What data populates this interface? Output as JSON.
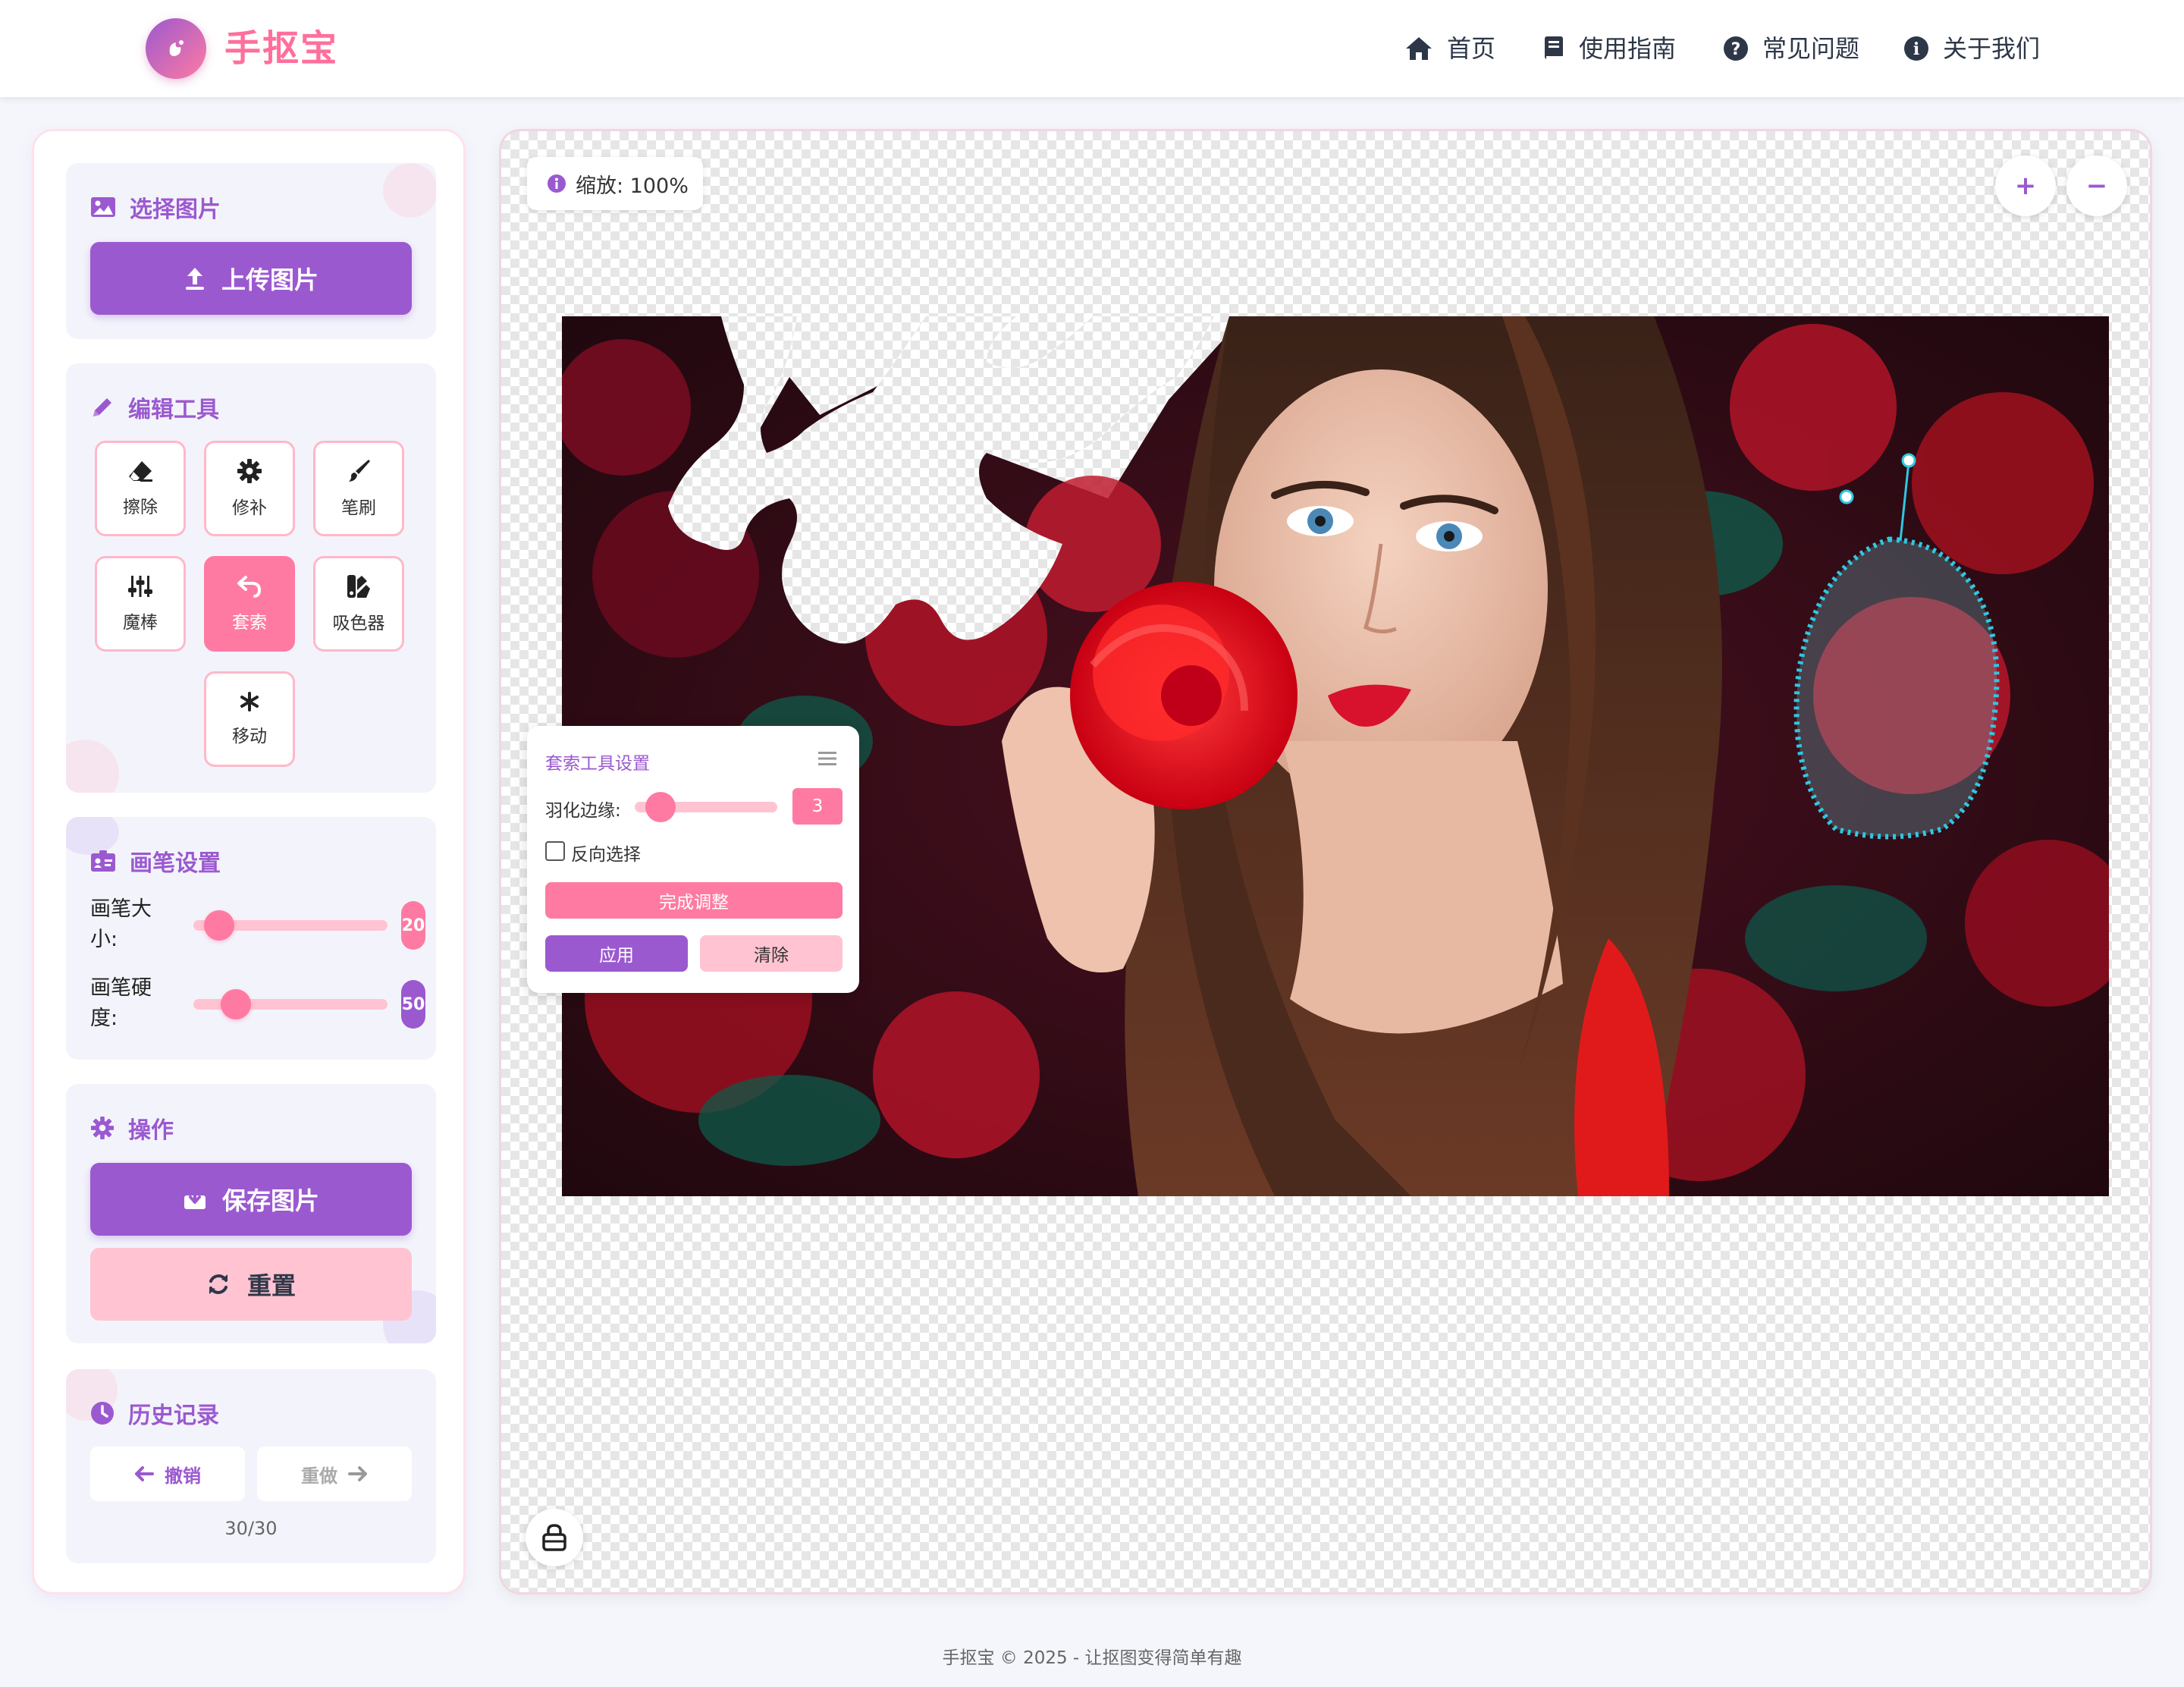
{
  "app": {
    "name": "手抠宝"
  },
  "nav": {
    "items": [
      {
        "label": "首页",
        "icon": "home-icon"
      },
      {
        "label": "使用指南",
        "icon": "book-icon"
      },
      {
        "label": "常见问题",
        "icon": "question-icon"
      },
      {
        "label": "关于我们",
        "icon": "info-icon"
      }
    ]
  },
  "sidebar": {
    "select_image": {
      "title": "选择图片",
      "upload_label": "上传图片"
    },
    "edit_tools": {
      "title": "编辑工具",
      "tools": [
        {
          "label": "擦除",
          "icon": "eraser-icon",
          "active": false
        },
        {
          "label": "修补",
          "icon": "gear-icon",
          "active": false
        },
        {
          "label": "笔刷",
          "icon": "paintbrush-icon",
          "active": false
        },
        {
          "label": "魔棒",
          "icon": "sliders-icon",
          "active": false
        },
        {
          "label": "套索",
          "icon": "undo-arrow-icon",
          "active": true
        },
        {
          "label": "吸色器",
          "icon": "swatch-icon",
          "active": false
        },
        {
          "label": "移动",
          "icon": "asterisk-icon",
          "active": false
        }
      ]
    },
    "brush_settings": {
      "title": "画笔设置",
      "size_label": "画笔大小:",
      "size_label_line1": "画笔大",
      "size_label_line2": "小:",
      "size_value": "20",
      "size_fraction": 0.08,
      "hardness_label": "画笔硬度:",
      "hardness_label_line1": "画笔硬",
      "hardness_label_line2": "度:",
      "hardness_value": "50",
      "hardness_fraction": 0.17
    },
    "actions": {
      "title": "操作",
      "save_label": "保存图片",
      "reset_label": "重置"
    },
    "history": {
      "title": "历史记录",
      "undo_label": "撤销",
      "redo_label": "重做",
      "count": "30/30"
    }
  },
  "canvas": {
    "zoom_label": "缩放: 100%",
    "zoom_in": "+",
    "zoom_out": "−"
  },
  "lasso_panel": {
    "title": "套索工具设置",
    "feather_label": "羽化边缘:",
    "feather_value": "3",
    "invert_label": "反向选择",
    "invert_checked": false,
    "finish_label": "完成调整",
    "apply_label": "应用",
    "clear_label": "清除"
  },
  "footer": {
    "text": "手抠宝 © 2025 - 让抠图变得简单有趣"
  },
  "colors": {
    "primary_purple": "#9b59d0",
    "accent_pink": "#ff7aa2",
    "light_pink": "#ffc3d1",
    "logo_pink": "#ff6f9c"
  }
}
